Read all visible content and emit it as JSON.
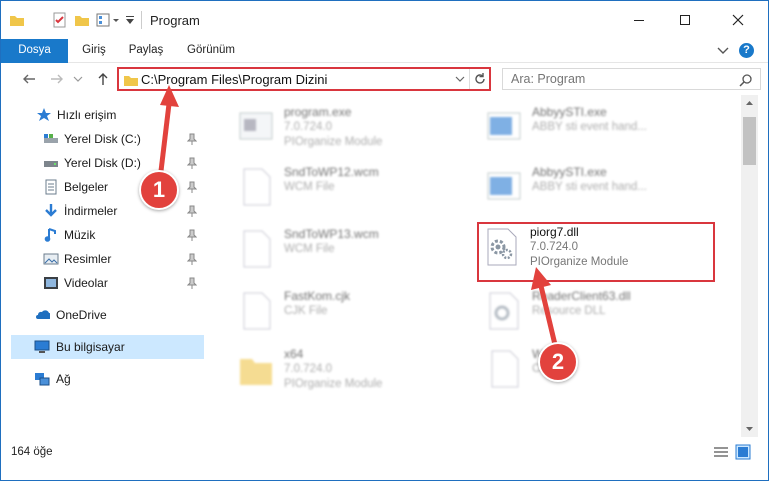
{
  "window": {
    "title": "Program"
  },
  "ribbon": {
    "tabs": [
      "Dosya",
      "Giriş",
      "Paylaş",
      "Görünüm"
    ]
  },
  "address": {
    "path": "C:\\Program Files\\Program Dizini"
  },
  "search": {
    "placeholder": "Ara: Program"
  },
  "sidebar": {
    "items": [
      {
        "label": "Hızlı erişim",
        "icon": "star-icon"
      },
      {
        "label": "Yerel Disk (C:)",
        "icon": "drive-icon",
        "pinned": true
      },
      {
        "label": "Yerel Disk (D:)",
        "icon": "drive-icon",
        "pinned": true
      },
      {
        "label": "Belgeler",
        "icon": "documents-icon",
        "pinned": true
      },
      {
        "label": "İndirmeler",
        "icon": "download-icon",
        "pinned": true
      },
      {
        "label": "Müzik",
        "icon": "music-icon",
        "pinned": true
      },
      {
        "label": "Resimler",
        "icon": "pictures-icon",
        "pinned": true
      },
      {
        "label": "Videolar",
        "icon": "videos-icon",
        "pinned": true
      },
      {
        "label": "OneDrive",
        "icon": "cloud-icon"
      },
      {
        "label": "Bu bilgisayar",
        "icon": "computer-icon",
        "selected": true
      },
      {
        "label": "Ağ",
        "icon": "network-icon"
      }
    ]
  },
  "files": [
    {
      "name": "program.exe",
      "version": "7.0.724.0",
      "desc": "PIOrganize Module",
      "icon": "exe-icon"
    },
    {
      "name": "AbbyySTI.exe",
      "version": "ABBY sti event hand...",
      "desc": "",
      "icon": "exe-icon"
    },
    {
      "name": "SndToWP12.wcm",
      "version": "WCM File",
      "desc": "",
      "icon": "file-icon"
    },
    {
      "name": "AbbyySTI.exe",
      "version": "ABBY sti event hand...",
      "desc": "",
      "icon": "exe-icon"
    },
    {
      "name": "SndToWP13.wcm",
      "version": "WCM File",
      "desc": "",
      "icon": "file-icon"
    },
    {
      "name": "piorg7.dll",
      "version": "7.0.724.0",
      "desc": "PIOrganize Module",
      "icon": "dll-gear-icon"
    },
    {
      "name": "FastKom.cjk",
      "version": "CJK File",
      "desc": "",
      "icon": "file-icon"
    },
    {
      "name": "ReaderClient63.dll",
      "version": "Resource DLL",
      "desc": "",
      "icon": "dll-gear-icon"
    },
    {
      "name": "x64",
      "version": "7.0.724.0",
      "desc": "PIOrganize Module",
      "icon": "folder-icon"
    },
    {
      "name": "W...",
      "version": "C...",
      "desc": "",
      "icon": "file-icon"
    }
  ],
  "status": {
    "item_count": "164 öğe"
  },
  "annotations": {
    "step1": "1",
    "step2": "2"
  },
  "colors": {
    "accent": "#1979ca",
    "highlight": "#d9363e",
    "selected_bg": "#cce8ff"
  }
}
